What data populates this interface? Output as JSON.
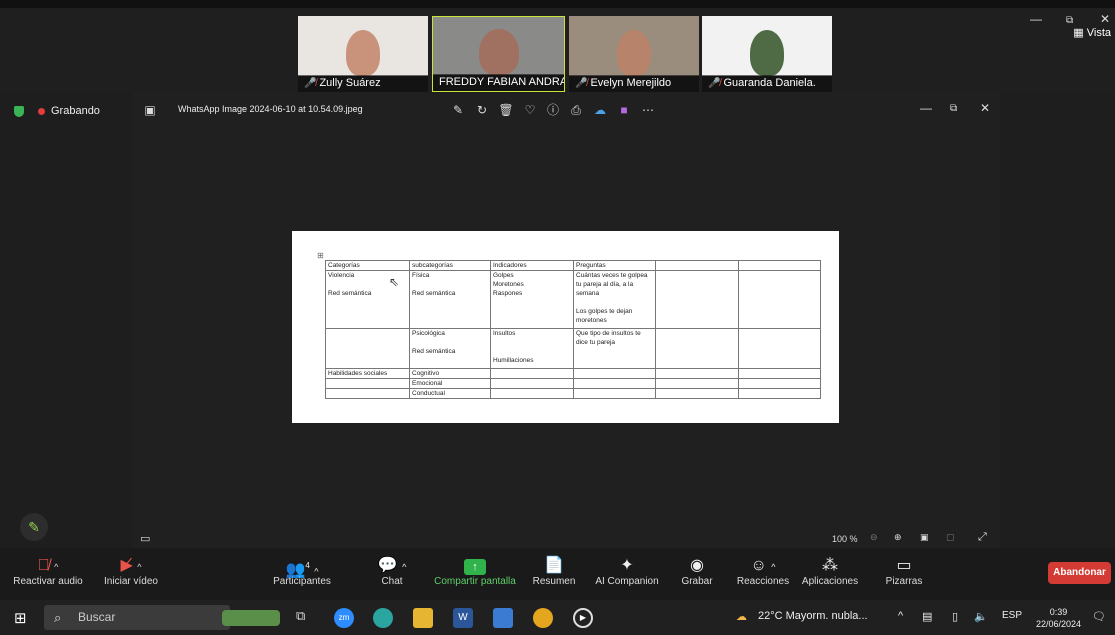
{
  "participants": [
    {
      "name": "Zully Suárez",
      "muted": true
    },
    {
      "name": "FREDDY FABIAN ANDRA...",
      "muted": false
    },
    {
      "name": "Evelyn Merejildo",
      "muted": true
    },
    {
      "name": "Guaranda Daniela.",
      "muted": true
    }
  ],
  "top_right": {
    "view_label": "Vista"
  },
  "recording": {
    "label": "Grabando"
  },
  "viewer": {
    "title": "WhatsApp Image 2024-06-10 at 10.54.09.jpeg",
    "zoom": "100 %"
  },
  "doc_table": {
    "header": [
      "Categorías",
      "subcategorías",
      "Indicadores",
      "Preguntas",
      "",
      ""
    ],
    "rows": [
      [
        "Violencia\n\nRed semántica",
        "Física\n\nRed semántica",
        "Golpes\nMoretones\nRaspones",
        "Cuántas veces te golpea tu pareja al día, a la semana\n\nLos golpes te dejan moretones",
        "",
        ""
      ],
      [
        "",
        "Psicológica\n\nRed semántica",
        "Insultos\n\n\nHumillaciones",
        "Que tipo de insultos te dice tu pareja",
        "",
        ""
      ],
      [
        "Habilidades sociales",
        "Cognitivo",
        "",
        "",
        "",
        ""
      ],
      [
        "",
        "Emocional",
        "",
        "",
        "",
        ""
      ],
      [
        "",
        "Conductual",
        "",
        "",
        "",
        ""
      ]
    ]
  },
  "toolbar": {
    "unmute": "Reactivar audio",
    "start_video": "Iniciar vídeo",
    "participants": "Participantes",
    "participants_count": "4",
    "chat": "Chat",
    "share": "Compartir pantalla",
    "summary": "Resumen",
    "ai": "AI Companion",
    "record": "Grabar",
    "reactions": "Reacciones",
    "apps": "Aplicaciones",
    "whiteboards": "Pizarras",
    "leave": "Abandonar"
  },
  "taskbar": {
    "search_placeholder": "Buscar",
    "weather": "22°C Mayorm. nubla...",
    "language": "ESP",
    "time": "0:39",
    "date": "22/06/2024"
  },
  "colors": {
    "accent_green": "#2fb34a",
    "leave_red": "#d43b34",
    "active_speaker": "#c9e53a"
  }
}
